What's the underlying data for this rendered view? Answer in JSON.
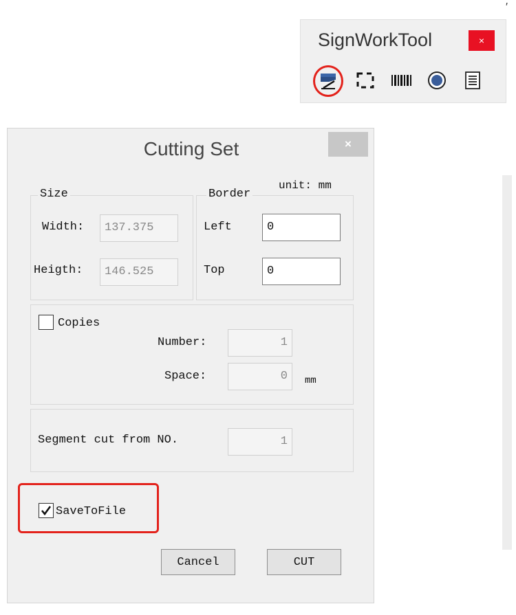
{
  "colors": {
    "highlight": "#e3221b",
    "close_red": "#e81123",
    "dialog_bg": "#f0f0f0"
  },
  "signworktool": {
    "title": "SignWorkTool",
    "close_glyph": "×",
    "tools": [
      {
        "icon": "cutter-icon",
        "highlighted": true
      },
      {
        "icon": "dashed-frame-icon"
      },
      {
        "icon": "barcode-icon"
      },
      {
        "icon": "circle-icon"
      },
      {
        "icon": "list-icon"
      }
    ]
  },
  "dialog": {
    "title": "Cutting Set",
    "close_glyph": "×",
    "unit_label": "unit: mm",
    "size": {
      "legend": "Size",
      "width_label": "Width:",
      "width_value": "137.375",
      "height_label": "Heigth:",
      "height_value": "146.525"
    },
    "border": {
      "legend": "Border",
      "left_label": "Left",
      "left_value": "0",
      "top_label": "Top",
      "top_value": "0"
    },
    "copies": {
      "label": "Copies",
      "checked": false,
      "number_label": "Number:",
      "number_value": "1",
      "space_label": "Space:",
      "space_value": "0",
      "space_unit": "mm"
    },
    "segment": {
      "label": "Segment cut from NO.",
      "value": "1"
    },
    "save_to_file": {
      "label": "SaveToFile",
      "checked": true
    },
    "buttons": {
      "cancel": "Cancel",
      "cut": "CUT"
    }
  }
}
